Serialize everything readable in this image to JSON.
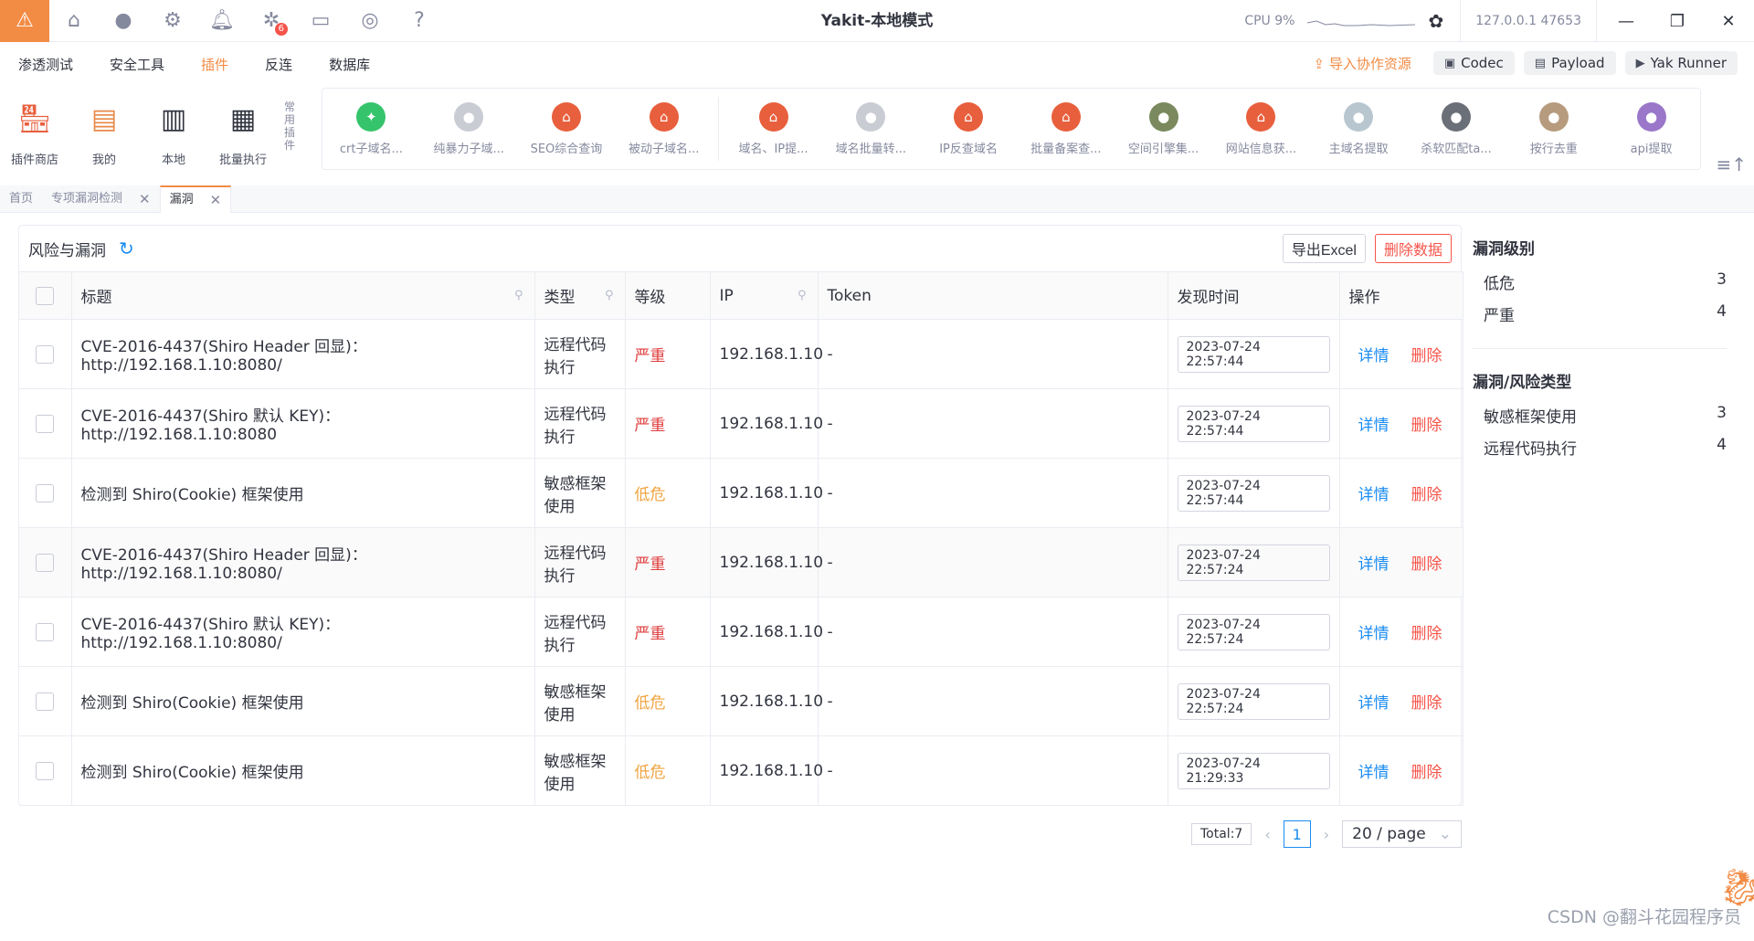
{
  "app": {
    "title": "Yakit-本地模式",
    "cpu": "CPU 9%",
    "addr": "127.0.0.1 47653",
    "accent": "#f28b44"
  },
  "topbar": {
    "bug_badge": "6"
  },
  "menu": {
    "items": [
      "渗透测试",
      "安全工具",
      "插件",
      "反连",
      "数据库"
    ],
    "import": "导入协作资源",
    "codec": "Codec",
    "payload": "Payload",
    "runner": "Yak Runner"
  },
  "fixed": [
    {
      "label": "插件商店"
    },
    {
      "label": "我的"
    },
    {
      "label": "本地"
    },
    {
      "label": "批量执行"
    }
  ],
  "common_label": "常用插件",
  "plugins": [
    {
      "label": "crt子域名...",
      "color": "#35c46b"
    },
    {
      "label": "纯暴力子域...",
      "color": "#c9ccd3"
    },
    {
      "label": "SEO综合查询",
      "color": "#e85f3d"
    },
    {
      "label": "被动子域名...",
      "color": "#e85f3d"
    },
    {
      "label": "域名、IP提...",
      "color": "#e85f3d"
    },
    {
      "label": "域名批量转...",
      "color": "#c9ccd3"
    },
    {
      "label": "IP反查域名",
      "color": "#e85f3d"
    },
    {
      "label": "批量备案查...",
      "color": "#e85f3d"
    },
    {
      "label": "空间引擎集...",
      "color": "#7a8a5e"
    },
    {
      "label": "网站信息获...",
      "color": "#e85f3d"
    },
    {
      "label": "主域名提取",
      "color": "#b8c6d0"
    },
    {
      "label": "杀软匹配ta...",
      "color": "#6b6f78"
    },
    {
      "label": "按行去重",
      "color": "#b79b7e"
    },
    {
      "label": "api提取",
      "color": "#9a77c9"
    }
  ],
  "tabs": [
    {
      "label": "首页"
    },
    {
      "label": "专项漏洞检测"
    },
    {
      "label": "漏洞"
    }
  ],
  "panel": {
    "title": "风险与漏洞",
    "export": "导出Excel",
    "delete": "删除数据",
    "columns": [
      "标题",
      "类型",
      "等级",
      "IP",
      "Token",
      "发现时间",
      "操作"
    ],
    "detail_label": "详情",
    "delete_label": "删除",
    "rows": [
      {
        "title": "CVE-2016-4437(Shiro Header 回显)：http://192.168.1.10:8080/",
        "type": "远程代码执行",
        "level": "严重",
        "ip": "192.168.1.10",
        "token": "-",
        "time": "2023-07-24 22:57:44"
      },
      {
        "title": "CVE-2016-4437(Shiro 默认 KEY)：http://192.168.1.10:8080",
        "type": "远程代码执行",
        "level": "严重",
        "ip": "192.168.1.10",
        "token": "-",
        "time": "2023-07-24 22:57:44"
      },
      {
        "title": "检测到 Shiro(Cookie) 框架使用",
        "type": "敏感框架使用",
        "level": "低危",
        "ip": "192.168.1.10",
        "token": "-",
        "time": "2023-07-24 22:57:44"
      },
      {
        "title": "CVE-2016-4437(Shiro Header 回显)：http://192.168.1.10:8080/",
        "type": "远程代码执行",
        "level": "严重",
        "ip": "192.168.1.10",
        "token": "-",
        "time": "2023-07-24 22:57:24"
      },
      {
        "title": "CVE-2016-4437(Shiro 默认 KEY)：http://192.168.1.10:8080/",
        "type": "远程代码执行",
        "level": "严重",
        "ip": "192.168.1.10",
        "token": "-",
        "time": "2023-07-24 22:57:24"
      },
      {
        "title": "检测到 Shiro(Cookie) 框架使用",
        "type": "敏感框架使用",
        "level": "低危",
        "ip": "192.168.1.10",
        "token": "-",
        "time": "2023-07-24 22:57:24"
      },
      {
        "title": "检测到 Shiro(Cookie) 框架使用",
        "type": "敏感框架使用",
        "level": "低危",
        "ip": "192.168.1.10",
        "token": "-",
        "time": "2023-07-24 21:29:33"
      }
    ],
    "total": "Total:7",
    "page": "1",
    "page_size": "20 / page"
  },
  "side": {
    "level_title": "漏洞级别",
    "levels": [
      {
        "name": "低危",
        "count": "3"
      },
      {
        "name": "严重",
        "count": "4"
      }
    ],
    "type_title": "漏洞/风险类型",
    "types": [
      {
        "name": "敏感框架使用",
        "count": "3"
      },
      {
        "name": "远程代码执行",
        "count": "4"
      }
    ]
  },
  "watermark": "CSDN @翻斗花园程序员"
}
